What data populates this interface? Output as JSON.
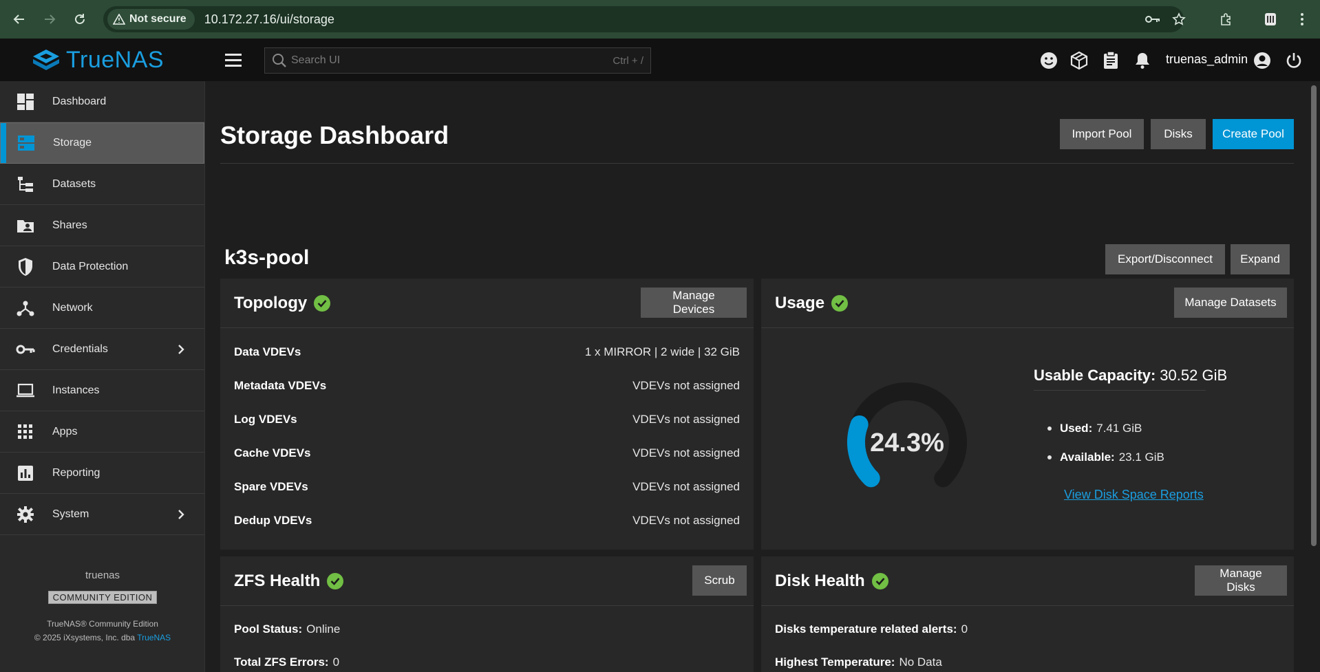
{
  "browser": {
    "security_label": "Not secure",
    "url": "10.172.27.16/ui/storage"
  },
  "app": {
    "logo_text": "TrueNAS",
    "search_placeholder": "Search UI",
    "search_shortcut": "Ctrl + /",
    "username": "truenas_admin",
    "accent": "#0095d5"
  },
  "sidebar": {
    "items": [
      {
        "label": "Dashboard",
        "icon": "dashboard-icon"
      },
      {
        "label": "Storage",
        "icon": "storage-icon"
      },
      {
        "label": "Datasets",
        "icon": "datasets-icon"
      },
      {
        "label": "Shares",
        "icon": "shares-icon"
      },
      {
        "label": "Data Protection",
        "icon": "shield-icon"
      },
      {
        "label": "Network",
        "icon": "network-icon"
      },
      {
        "label": "Credentials",
        "icon": "key-icon"
      },
      {
        "label": "Instances",
        "icon": "laptop-icon"
      },
      {
        "label": "Apps",
        "icon": "apps-icon"
      },
      {
        "label": "Reporting",
        "icon": "chart-icon"
      },
      {
        "label": "System",
        "icon": "gear-icon"
      }
    ],
    "active": "Storage",
    "footer": {
      "hostname": "truenas",
      "edition": "COMMUNITY EDITION",
      "product": "TrueNAS® Community Edition",
      "copyright": "© 2025 iXsystems, Inc. dba",
      "copyright_link": "TrueNAS"
    }
  },
  "page": {
    "title": "Storage Dashboard",
    "buttons": {
      "import_pool": "Import Pool",
      "disks": "Disks",
      "create_pool": "Create Pool"
    }
  },
  "pool": {
    "name": "k3s-pool",
    "export_label": "Export/Disconnect",
    "expand_label": "Expand",
    "topology": {
      "title": "Topology",
      "button": "Manage Devices",
      "rows": [
        {
          "label": "Data VDEVs",
          "value": "1 x MIRROR | 2 wide | 32 GiB"
        },
        {
          "label": "Metadata VDEVs",
          "value": "VDEVs not assigned"
        },
        {
          "label": "Log VDEVs",
          "value": "VDEVs not assigned"
        },
        {
          "label": "Cache VDEVs",
          "value": "VDEVs not assigned"
        },
        {
          "label": "Spare VDEVs",
          "value": "VDEVs not assigned"
        },
        {
          "label": "Dedup VDEVs",
          "value": "VDEVs not assigned"
        }
      ]
    },
    "usage": {
      "title": "Usage",
      "button": "Manage Datasets",
      "percent_label": "24.3%",
      "percent": 24.3,
      "capacity_label": "Usable Capacity:",
      "capacity_value": "30.52 GiB",
      "used_label": "Used:",
      "used_value": "7.41 GiB",
      "available_label": "Available:",
      "available_value": "23.1 GiB",
      "report_link": "View Disk Space Reports"
    },
    "zfs_health": {
      "title": "ZFS Health",
      "button": "Scrub",
      "pool_status_label": "Pool Status:",
      "pool_status_value": "Online",
      "errors_label": "Total ZFS Errors:",
      "errors_value": "0"
    },
    "disk_health": {
      "title": "Disk Health",
      "button": "Manage Disks",
      "temp_alerts_label": "Disks temperature related alerts:",
      "temp_alerts_value": "0",
      "highest_temp_label": "Highest Temperature:",
      "highest_temp_value": "No Data"
    }
  }
}
